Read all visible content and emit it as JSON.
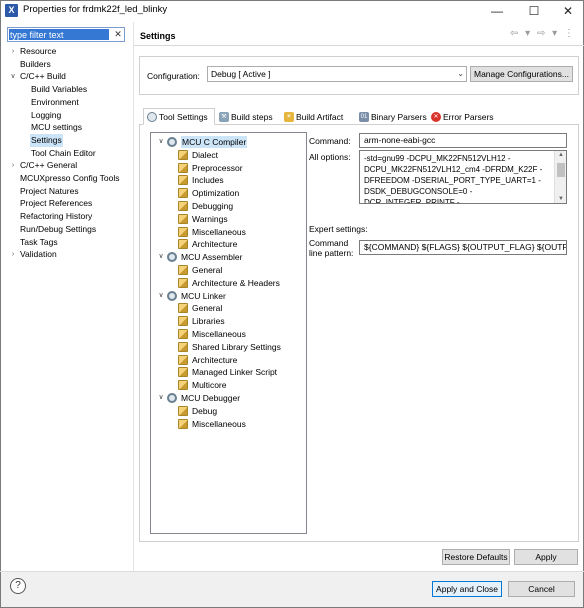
{
  "window": {
    "icon_letter": "X",
    "title": "Properties for frdmk22f_led_blinky",
    "controls": {
      "minimize": "—",
      "maximize": "☐",
      "close": "✕"
    }
  },
  "filter": {
    "value": "type filter text",
    "clear": "✕"
  },
  "nav_tree": [
    {
      "label": "Resource",
      "arrow": ">",
      "level": 0
    },
    {
      "label": "Builders",
      "arrow": "",
      "level": 0
    },
    {
      "label": "C/C++ Build",
      "arrow": "v",
      "level": 0
    },
    {
      "label": "Build Variables",
      "arrow": "",
      "level": 1
    },
    {
      "label": "Environment",
      "arrow": "",
      "level": 1
    },
    {
      "label": "Logging",
      "arrow": "",
      "level": 1
    },
    {
      "label": "MCU settings",
      "arrow": "",
      "level": 1
    },
    {
      "label": "Settings",
      "arrow": "",
      "level": 1,
      "selected": true
    },
    {
      "label": "Tool Chain Editor",
      "arrow": "",
      "level": 1
    },
    {
      "label": "C/C++ General",
      "arrow": ">",
      "level": 0
    },
    {
      "label": "MCUXpresso Config Tools",
      "arrow": "",
      "level": 0
    },
    {
      "label": "Project Natures",
      "arrow": "",
      "level": 0
    },
    {
      "label": "Project References",
      "arrow": "",
      "level": 0
    },
    {
      "label": "Refactoring History",
      "arrow": "",
      "level": 0
    },
    {
      "label": "Run/Debug Settings",
      "arrow": "",
      "level": 0
    },
    {
      "label": "Task Tags",
      "arrow": "",
      "level": 0
    },
    {
      "label": "Validation",
      "arrow": ">",
      "level": 0
    }
  ],
  "page": {
    "title": "Settings",
    "nav_arrows": "⇦ ▾ ⇨ ▾ ⋮"
  },
  "configuration": {
    "label": "Configuration:",
    "value": "Debug  [ Active ]",
    "manage_button": "Manage Configurations..."
  },
  "tabs": [
    {
      "label": "Tool Settings",
      "icon": "tool-settings-icon",
      "active": true
    },
    {
      "label": "Build steps",
      "icon": "build-steps-icon"
    },
    {
      "label": "Build Artifact",
      "icon": "build-artifact-icon"
    },
    {
      "label": "Binary Parsers",
      "icon": "binary-parsers-icon"
    },
    {
      "label": "Error Parsers",
      "icon": "error-parsers-icon"
    }
  ],
  "tool_tree": [
    {
      "label": "MCU C Compiler",
      "type": "tool",
      "level": 0,
      "arrow": "v",
      "selected": true
    },
    {
      "label": "Dialect",
      "type": "option",
      "level": 1
    },
    {
      "label": "Preprocessor",
      "type": "option",
      "level": 1
    },
    {
      "label": "Includes",
      "type": "option",
      "level": 1
    },
    {
      "label": "Optimization",
      "type": "option",
      "level": 1
    },
    {
      "label": "Debugging",
      "type": "option",
      "level": 1
    },
    {
      "label": "Warnings",
      "type": "option",
      "level": 1
    },
    {
      "label": "Miscellaneous",
      "type": "option",
      "level": 1
    },
    {
      "label": "Architecture",
      "type": "option",
      "level": 1
    },
    {
      "label": "MCU Assembler",
      "type": "tool",
      "level": 0,
      "arrow": "v"
    },
    {
      "label": "General",
      "type": "option",
      "level": 1
    },
    {
      "label": "Architecture & Headers",
      "type": "option",
      "level": 1
    },
    {
      "label": "MCU Linker",
      "type": "tool",
      "level": 0,
      "arrow": "v"
    },
    {
      "label": "General",
      "type": "option",
      "level": 1
    },
    {
      "label": "Libraries",
      "type": "option",
      "level": 1
    },
    {
      "label": "Miscellaneous",
      "type": "option",
      "level": 1
    },
    {
      "label": "Shared Library Settings",
      "type": "option",
      "level": 1
    },
    {
      "label": "Architecture",
      "type": "option",
      "level": 1
    },
    {
      "label": "Managed Linker Script",
      "type": "option",
      "level": 1
    },
    {
      "label": "Multicore",
      "type": "option",
      "level": 1
    },
    {
      "label": "MCU Debugger",
      "type": "tool",
      "level": 0,
      "arrow": "v"
    },
    {
      "label": "Debug",
      "type": "option",
      "level": 1
    },
    {
      "label": "Miscellaneous",
      "type": "option",
      "level": 1
    }
  ],
  "settings": {
    "command_label": "Command:",
    "command_value": "arm-none-eabi-gcc",
    "all_options_label": "All options:",
    "all_options_lines": [
      "-std=gnu99 -DCPU_MK22FN512VLH12 -",
      "DCPU_MK22FN512VLH12_cm4 -DFRDM_K22F -",
      "DFREEDOM -DSERIAL_PORT_TYPE_UART=1 -",
      "DSDK_DEBUGCONSOLE=0 -",
      "DCR_INTEGER_PRINTF -"
    ],
    "expert_label": "Expert settings:",
    "pattern_label_1": "Command",
    "pattern_label_2": "line pattern:",
    "pattern_value": "${COMMAND} ${FLAGS} ${OUTPUT_FLAG} ${OUTPUT"
  },
  "buttons": {
    "restore_defaults": "Restore Defaults",
    "apply": "Apply",
    "apply_and_close": "Apply and Close",
    "cancel": "Cancel",
    "help": "?"
  },
  "colors": {
    "selection": "#cce4f7",
    "primary_border": "#0078d7",
    "filter_highlight": "#3478d4"
  }
}
